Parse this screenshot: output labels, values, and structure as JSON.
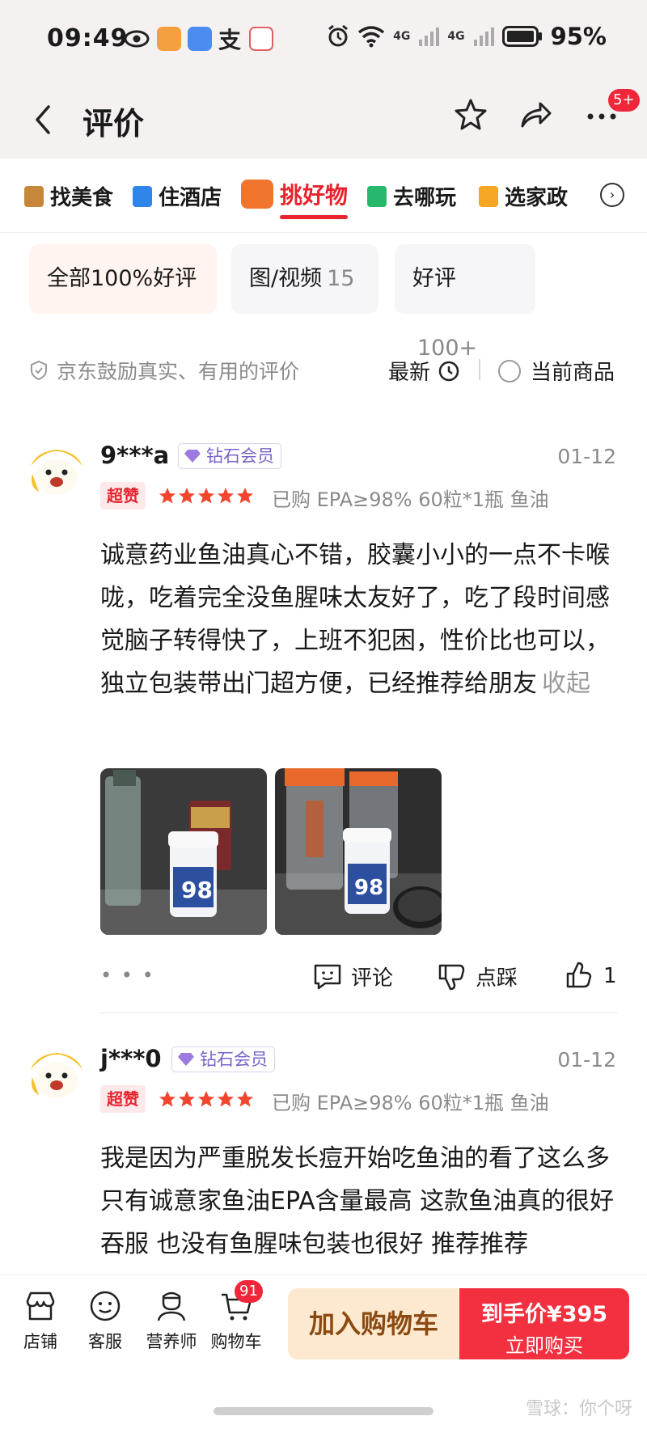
{
  "status_bar": {
    "time": "09:49",
    "network_1": "4G",
    "network_2": "4G",
    "battery": "95%"
  },
  "header": {
    "title": "评价",
    "more_badge": "5+"
  },
  "categories": [
    {
      "label": "找美食",
      "color": "#c7873a"
    },
    {
      "label": "住酒店",
      "color": "#2f86e8"
    },
    {
      "label": "挑好物",
      "color": "#f0762d",
      "active": true
    },
    {
      "label": "去哪玩",
      "color": "#27b86b"
    },
    {
      "label": "选家政",
      "color": "#f5a623"
    }
  ],
  "filters": [
    {
      "label": "全部",
      "count": "100%好评",
      "active": true
    },
    {
      "label": "图/视频",
      "count": "15"
    },
    {
      "label": "好评",
      "count": "100+"
    }
  ],
  "toolbar": {
    "encourage": "京东鼓励真实、有用的评价",
    "sort_label": "最新",
    "current_item": "当前商品"
  },
  "reviews": [
    {
      "user": "9***a",
      "member": "钻石会员",
      "date": "01-12",
      "tag": "超赞",
      "rating": 5,
      "purchased": "已购 EPA≥98% 60粒*1瓶 鱼油",
      "text": "诚意药业鱼油真心不错，胶囊小小的一点不卡喉咙，吃着完全没鱼腥味太友好了，吃了段时间感觉脑子转得快了，上班不犯困，性价比也可以，独立包装带出门超方便，已经推荐给朋友",
      "collapse": "收起",
      "comment_label": "评论",
      "dislike_label": "点踩",
      "like_count": "1"
    },
    {
      "user": "j***0",
      "member": "钻石会员",
      "date": "01-12",
      "tag": "超赞",
      "rating": 5,
      "purchased": "已购 EPA≥98% 60粒*1瓶 鱼油",
      "text": "我是因为严重脱发长痘开始吃鱼油的看了这么多 只有诚意家鱼油EPA含量最高 这款鱼油真的很好吞服 也没有鱼腥味包装也很好 推荐推荐"
    }
  ],
  "bottom_bar": {
    "tabs": [
      "店铺",
      "客服",
      "营养师",
      "购物车"
    ],
    "cart_badge": "91",
    "add_to_cart": "加入购物车",
    "price_label": "到手价¥395",
    "buy_now": "立即购买"
  },
  "watermark": "雪球：你个呀",
  "colors": {
    "accent": "#e8232e",
    "buy": "#f23040",
    "cart_bg": "#fde9cf"
  }
}
